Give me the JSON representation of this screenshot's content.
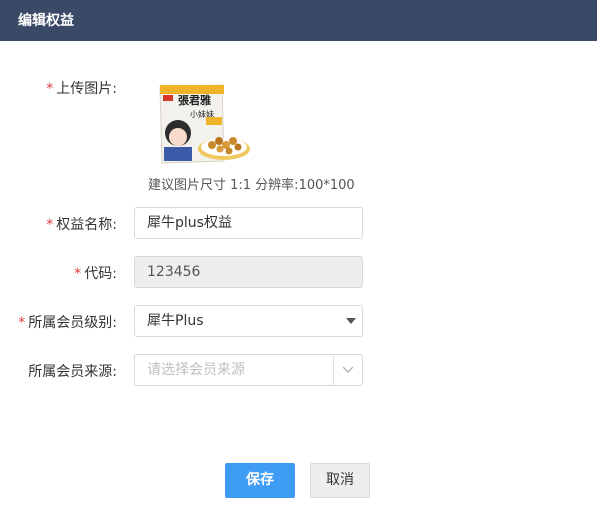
{
  "dialog": {
    "title": "编辑权益"
  },
  "form": {
    "upload": {
      "label": "上传图片:",
      "required": true,
      "hint": "建议图片尺寸 1:1 分辨率:100*100"
    },
    "name": {
      "label": "权益名称:",
      "required": true,
      "value": "犀牛plus权益"
    },
    "code": {
      "label": "代码:",
      "required": true,
      "value": "123456"
    },
    "level": {
      "label": "所属会员级别:",
      "required": true,
      "selected": "犀牛Plus"
    },
    "source": {
      "label": "所属会员来源:",
      "required": false,
      "placeholder": "请选择会员来源"
    }
  },
  "buttons": {
    "save": "保存",
    "cancel": "取消"
  },
  "product_image": {
    "brand_text": "張君雅",
    "sub_text": "小妹妹"
  },
  "colors": {
    "header_bg": "#3a4a66",
    "primary": "#3e9cf4",
    "required": "#e23b3b"
  },
  "required_mark": "*"
}
